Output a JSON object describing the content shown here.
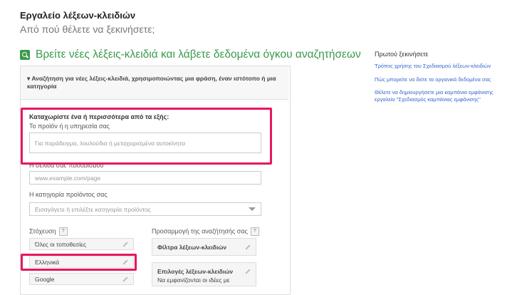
{
  "header": {
    "title": "Εργαλείο λέξεων-κλειδιών",
    "subtitle": "Από πού θέλετε να ξεκινήσετε;"
  },
  "section": {
    "title": "Βρείτε νέες λέξεις-κλειδιά και λάβετε δεδομένα όγκου αναζητήσεων",
    "icon": "search-icon",
    "accent_color": "#3a9a4b"
  },
  "panel": {
    "header_text": "▾ Αναζήτηση για νέες λέξεις-κλειδιά, χρησιμοποιώντας μια φράση, έναν ιστότοπο ή μια κατηγορία",
    "instruction": "Καταχωρίστε ένα ή περισσότερα από τα εξής:",
    "product_label": "Το προϊόν ή η υπηρεσία σας",
    "product_placeholder": "Για παράδειγμα, λουλούδια ή μεταχειρισμένα αυτοκίνητα",
    "landing_label": "Η σελίδα σας προορισμού",
    "landing_placeholder": "www.example.com/page",
    "category_label": "Η κατηγορία προϊόντος σας",
    "category_placeholder": "Εισαγάγετε ή επιλέξτε κατηγορία προϊόντος",
    "targeting_label": "Στόχευση",
    "targeting_help": "?",
    "targeting_items": [
      "Όλες οι τοποθεσίες",
      "Ελληνικά",
      "Google"
    ],
    "customize_label": "Προσαρμογή της αναζήτησής σας",
    "customize_help": "?",
    "keyword_filters": "Φίλτρα λέξεων-κλειδιών",
    "keyword_options": "Επιλογές λέξεων-κλειδιών",
    "keyword_options_sub": "Να εμφανίζονται οι ιδέες με"
  },
  "sidebar": {
    "title": "Πρωτού ξεκινήσετε",
    "links": [
      "Τρόπος χρήσης του Σχεδιασμού λέξεων-κλειδιών",
      "Πώς μπορείτε να δείτε τα οργανικά δεδομένα σας",
      "Θέλετε να δημιουργήσετε μια καμπάνια εμφάνισης",
      "εργαλείο \"Σχεδιασμός καμπάνιας εμφάνισης\""
    ]
  },
  "highlight_color": "#e8175d"
}
